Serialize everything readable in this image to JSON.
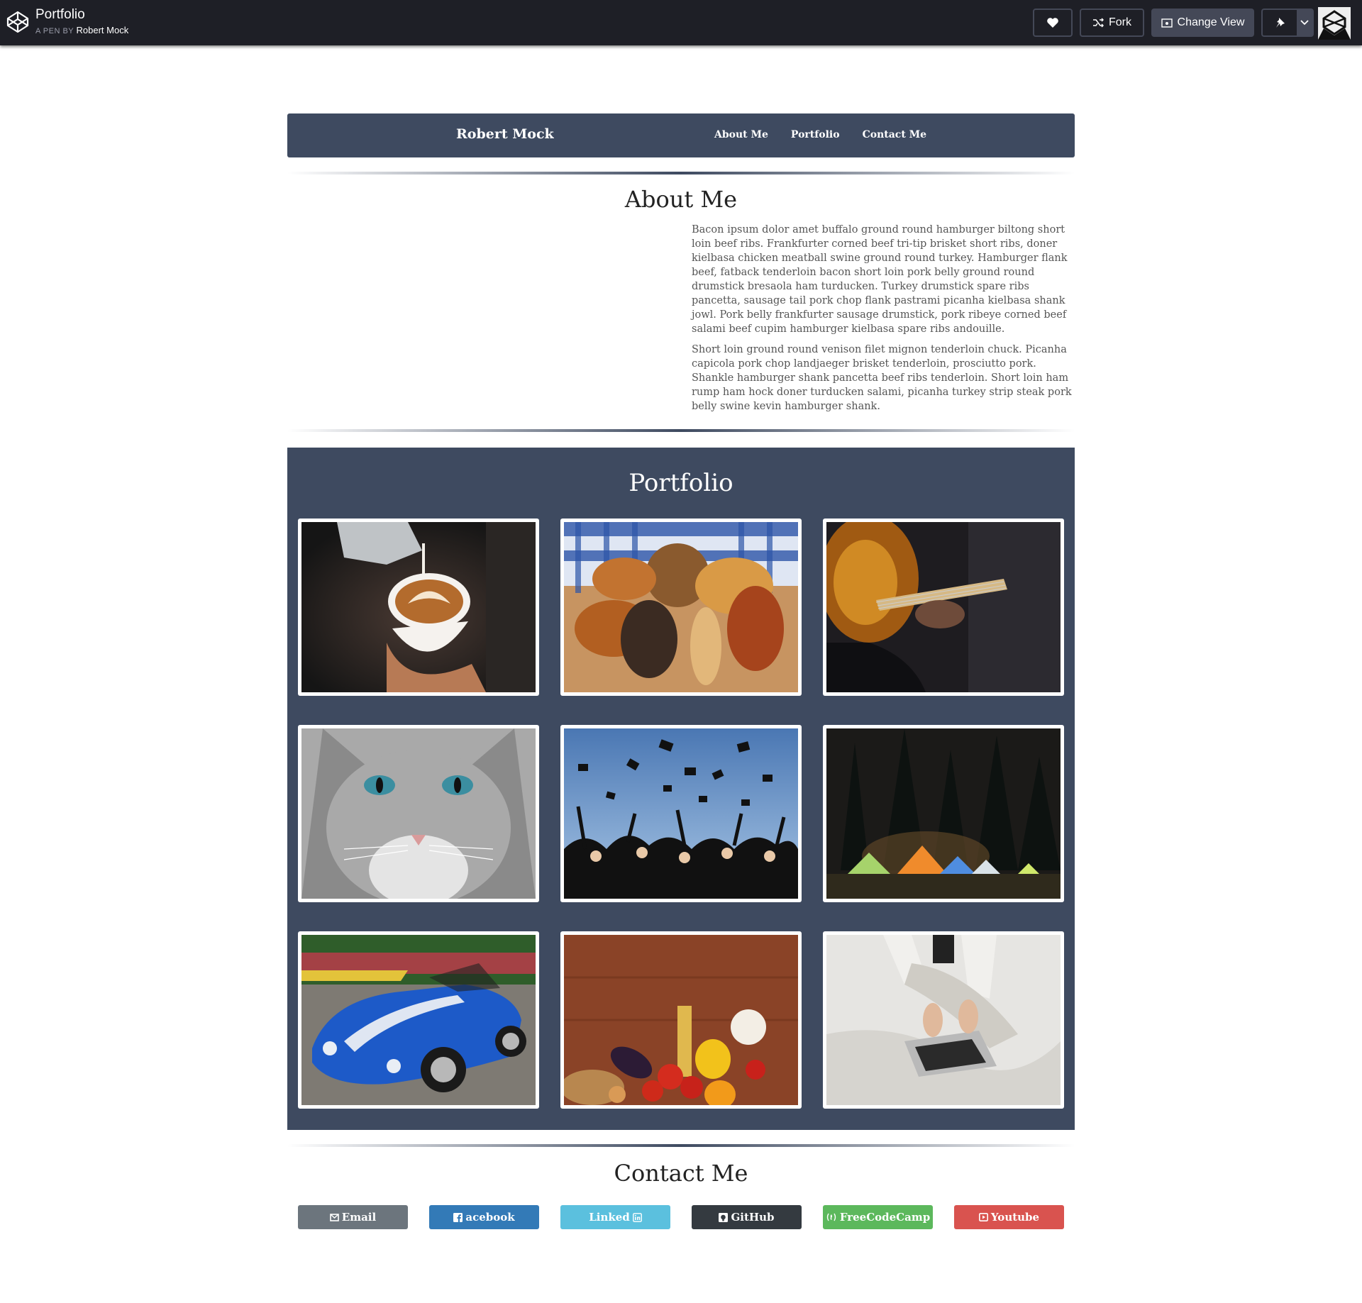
{
  "codepen": {
    "title": "Portfolio",
    "pen_by": "A PEN BY",
    "author": "Robert Mock",
    "fork_label": "Fork",
    "change_view_label": "Change View",
    "icons": [
      "codepen-logo-icon",
      "heart-icon",
      "fork-icon",
      "view-icon",
      "pin-icon",
      "chevron-down-icon"
    ]
  },
  "nav": {
    "brand": "Robert Mock",
    "links": [
      "About Me",
      "Portfolio",
      "Contact Me"
    ]
  },
  "about": {
    "heading": "About Me",
    "paragraphs": [
      "Bacon ipsum dolor amet buffalo ground round hamburger biltong short loin beef ribs. Frankfurter corned beef tri-tip brisket short ribs, doner kielbasa chicken meatball swine ground round turkey. Hamburger flank beef, fatback tenderloin bacon short loin pork belly ground round drumstick bresaola ham turducken. Turkey drumstick spare ribs pancetta, sausage tail pork chop flank pastrami picanha kielbasa shank jowl. Pork belly frankfurter sausage drumstick, pork ribeye corned beef salami beef cupim hamburger kielbasa spare ribs andouille.",
      "Short loin ground round venison filet mignon tenderloin chuck. Picanha capicola pork chop landjaeger brisket tenderloin, prosciutto pork. Shankle hamburger shank pancetta beef ribs tenderloin. Short loin ham rump ham hock doner turducken salami, picanha turkey strip steak pork belly swine kevin hamburger shank."
    ]
  },
  "portfolio": {
    "heading": "Portfolio",
    "photos": [
      "latte-art-photo",
      "bread-rolls-photo",
      "guitar-photo",
      "cat-photo",
      "graduation-caps-photo",
      "night-camping-photo",
      "blue-cobra-car-photo",
      "vegetables-on-wood-photo",
      "laptop-on-bed-photo"
    ]
  },
  "contact": {
    "heading": "Contact Me",
    "buttons": [
      {
        "label": "Email",
        "color": "#6c757d",
        "icon": "envelope-icon"
      },
      {
        "label": "acebook",
        "color": "#337ab7",
        "icon": "facebook-icon"
      },
      {
        "label": "Linked",
        "color": "#5bc0de",
        "icon": "linkedin-icon"
      },
      {
        "label": "GitHub",
        "color": "#343a40",
        "icon": "github-icon"
      },
      {
        "label": "FreeCodeCamp",
        "color": "#5cb85c",
        "icon": "freecodecamp-icon"
      },
      {
        "label": "Youtube",
        "color": "#d9534f",
        "icon": "youtube-icon"
      }
    ]
  },
  "colors": {
    "navy": "#3e4a60",
    "topbar": "#1e1f26"
  }
}
